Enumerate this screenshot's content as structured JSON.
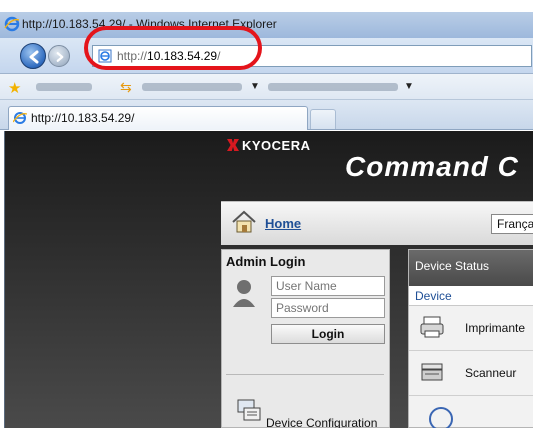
{
  "window": {
    "title": "http://10.183.54.29/ - Windows Internet Explorer"
  },
  "address_bar": {
    "prefix": "http://",
    "host": "10.183.54.29",
    "suffix": "/"
  },
  "favorites_bar": {
    "star_icon": "favorites-star-icon",
    "add_icon": "add-favorite-icon"
  },
  "tab": {
    "label": "http://10.183.54.29/"
  },
  "page": {
    "brand": "KYOCERA",
    "product_title": "Command C",
    "home_link": "Home",
    "language": "Françai",
    "admin_login": {
      "title": "Admin Login",
      "username_placeholder": "User Name",
      "password_placeholder": "Password",
      "login_button": "Login"
    },
    "device_configuration": "Device Configuration",
    "device_status": {
      "title": "Device Status",
      "device_label": "Device",
      "items": [
        {
          "label": "Imprimante",
          "icon": "printer-icon"
        },
        {
          "label": "Scanneur",
          "icon": "scanner-icon"
        }
      ]
    }
  },
  "colors": {
    "highlight": "#e4141b",
    "brand_red": "#d71920",
    "link_blue": "#1f4f96"
  }
}
